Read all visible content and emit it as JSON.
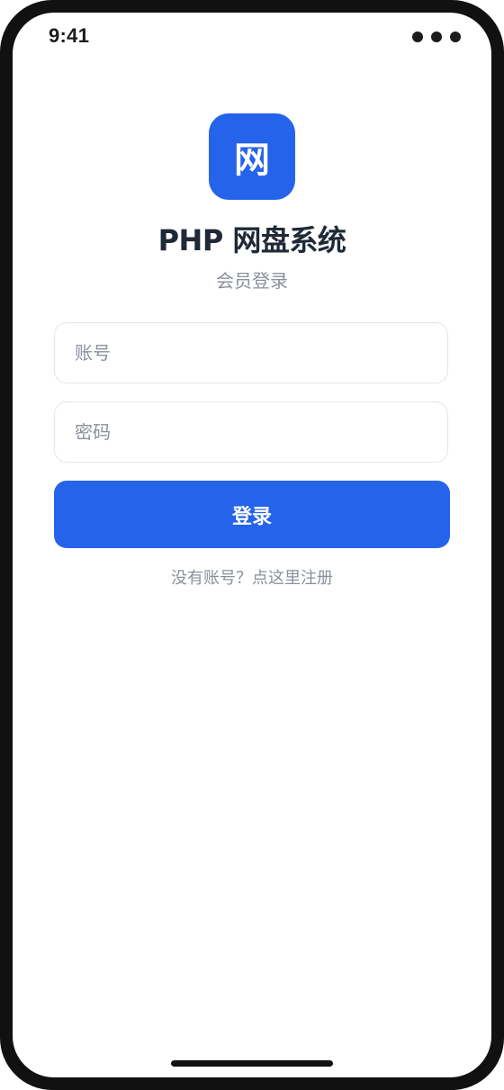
{
  "status_bar": {
    "time": "9:41"
  },
  "logo": {
    "glyph": "网"
  },
  "header": {
    "title": "PHP 网盘系统",
    "subtitle": "会员登录"
  },
  "form": {
    "account_placeholder": "账号",
    "password_placeholder": "密码",
    "login_label": "登录",
    "register_link": "没有账号？点这里注册"
  },
  "colors": {
    "accent": "#2563eb",
    "muted_text": "#8a919c",
    "title_text": "#1f2937"
  }
}
